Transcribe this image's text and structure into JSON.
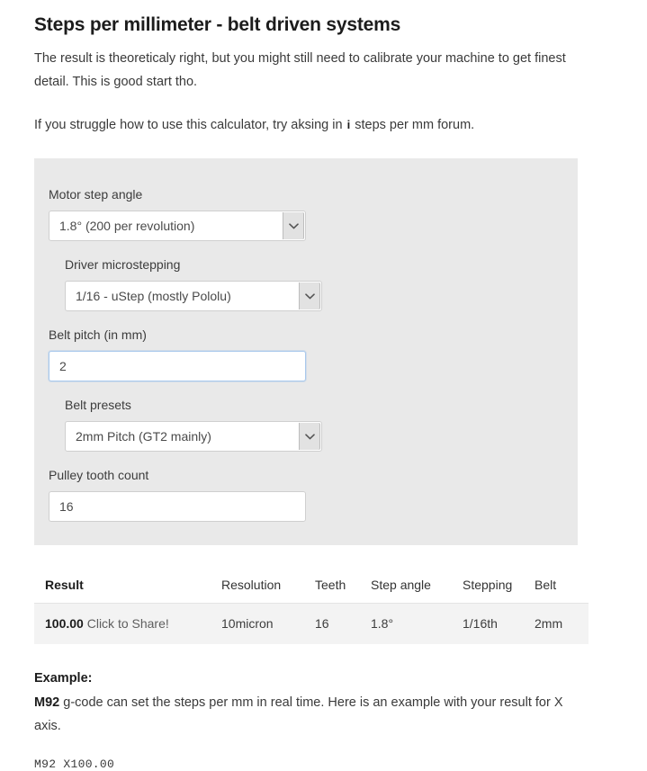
{
  "page": {
    "title": "Steps per millimeter - belt driven systems",
    "intro_1": "The result is theoreticaly right, but you might still need to calibrate your machine to get finest detail. This is good start tho.",
    "intro_2_before": "If you struggle how to use this calculator, try aksing in",
    "intro_2_icon": "i",
    "intro_2_after": "steps per mm forum."
  },
  "form": {
    "fields": [
      {
        "label": "Motor step angle",
        "type": "select",
        "value": "1.8° (200 per revolution)",
        "icon": "chevron-down-icon"
      },
      {
        "label": "Driver microstepping",
        "type": "select",
        "value": "1/16 - uStep (mostly Pololu)",
        "icon": "chevron-down-icon"
      },
      {
        "label": "Belt pitch (in mm)",
        "type": "text",
        "value": "2",
        "placeholder": "2",
        "focused": true
      },
      {
        "label": "Belt presets",
        "type": "select",
        "value": "2mm Pitch (GT2 mainly)",
        "icon": "chevron-down-icon"
      },
      {
        "label": "Pulley tooth count",
        "type": "text",
        "value": "16",
        "placeholder": "16",
        "focused": false
      }
    ]
  },
  "results": {
    "headers": [
      "Result",
      "Resolution",
      "Teeth",
      "Step angle",
      "Stepping",
      "Belt"
    ],
    "row": {
      "result_value": "100.00",
      "result_share": "Click to Share!",
      "resolution": "10micron",
      "teeth": "16",
      "step_angle": "1.8°",
      "stepping": "1/16th",
      "belt": "2mm"
    }
  },
  "example": {
    "heading": "Example:",
    "code_word": "M92",
    "body": "g-code can set the steps per mm in real time. Here is an example with your result for X axis.",
    "code": "M92 X100.00"
  },
  "colors": {
    "panel_bg": "#e9e9e9",
    "row_bg": "#f3f3f3",
    "focus_border": "#a9c9ec",
    "text": "#3a3a3a"
  }
}
